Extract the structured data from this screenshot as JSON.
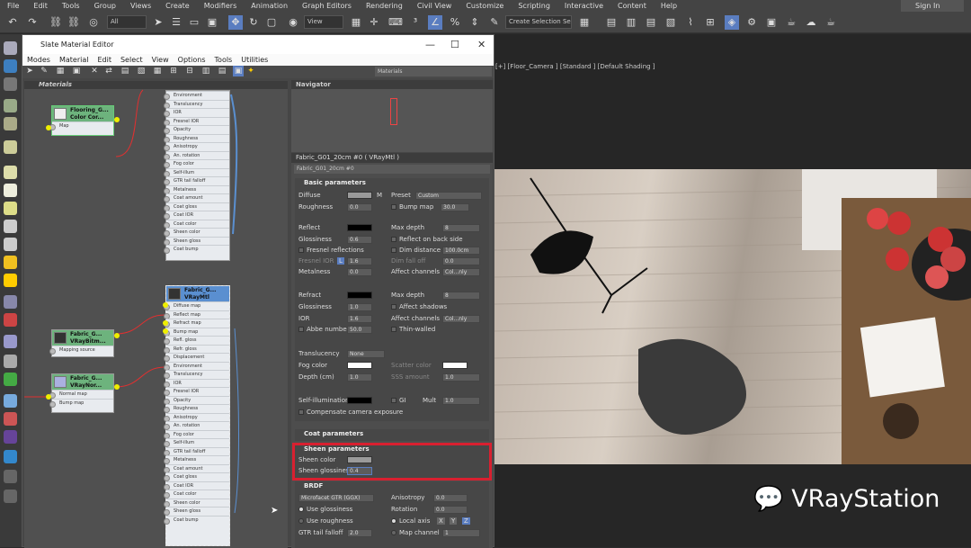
{
  "menubar": [
    "File",
    "Edit",
    "Tools",
    "Group",
    "Views",
    "Create",
    "Modifiers",
    "Animation",
    "Graph Editors",
    "Rendering",
    "Civil View",
    "Customize",
    "Scripting",
    "Interactive",
    "Content",
    "Help"
  ],
  "signin": "Sign In",
  "toolbar": {
    "filter": "All",
    "view": "View",
    "selection_set": "Create Selection Se"
  },
  "viewport": {
    "label": "[+] [Floor_Camera ] [Standard ] [Default Shading ]",
    "watermark": "VRayStation"
  },
  "sme": {
    "title": "Slate Material Editor",
    "menu": [
      "Modes",
      "Material",
      "Edit",
      "Select",
      "View",
      "Options",
      "Tools",
      "Utilities"
    ],
    "material_dropdown": "Materials",
    "graph_header": "Materials",
    "navigator": "Navigator"
  },
  "nodes": {
    "flooring": {
      "title": "Flooring_G...",
      "sub": "Color Cor...",
      "slots": [
        "Map"
      ]
    },
    "fab_bitmap": {
      "title": "Fabric_G...",
      "sub": "VRayBitm...",
      "slots": [
        "Mapping source"
      ]
    },
    "fab_normal": {
      "title": "Fabric_G...",
      "sub": "VRayNor...",
      "slots": [
        "Normal map",
        "Bump map"
      ]
    },
    "top_vraymtl_slots": [
      "Environment",
      "Translucency",
      "IOR",
      "Fresnel IOR",
      "Opacity",
      "Roughness",
      "Anisotropy",
      "An. rotation",
      "Fog color",
      "Self-illum",
      "GTR tail falloff",
      "Metalness",
      "Coat amount",
      "Coat gloss",
      "Coat IOR",
      "Coat color",
      "Sheen color",
      "Sheen gloss",
      "Coat bump"
    ],
    "fab_vraymtl": {
      "title": "Fabric_G...",
      "sub": "VRayMtl",
      "slots": [
        "Diffuse map",
        "Reflect map",
        "Refract map",
        "Bump map",
        "Refl. gloss",
        "Refr. gloss",
        "Displacement",
        "Environment",
        "Translucency",
        "IOR",
        "Fresnel IOR",
        "Opacity",
        "Roughness",
        "Anisotropy",
        "An. rotation",
        "Fog color",
        "Self-illum",
        "GTR tail falloff",
        "Metalness",
        "Coat amount",
        "Coat gloss",
        "Coat IOR",
        "Coat color",
        "Sheen color",
        "Sheen gloss",
        "Coat bump"
      ]
    }
  },
  "params": {
    "name": "Fabric_G01_20cm #0  ( VRayMtl )",
    "name_field": "Fabric_G01_20cm #0",
    "basic": {
      "header": "Basic parameters",
      "diffuse": "Diffuse",
      "m": "M",
      "preset": "Preset",
      "preset_val": "Custom",
      "roughness": "Roughness",
      "roughness_val": "0.0",
      "bump_map": "Bump map",
      "bump_val": "30.0",
      "reflect": "Reflect",
      "max_depth": "Max depth",
      "max_depth_val": "8",
      "glossiness": "Glossiness",
      "gloss_val": "0.6",
      "reflect_back": "Reflect on back side",
      "fresnel": "Fresnel reflections",
      "dim_distance": "Dim distance",
      "dim_val": "100.0cm",
      "fresnel_ior": "Fresnel IOR",
      "l": "L",
      "fior_val": "1.6",
      "dim_falloff": "Dim fall off",
      "dimf_val": "0.0",
      "metalness": "Metalness",
      "metal_val": "0.0",
      "affect_channels": "Affect channels",
      "aff_val": "Col...nly",
      "refract": "Refract",
      "max_depth2_val": "8",
      "r_gloss_val": "1.0",
      "affect_shadows": "Affect shadows",
      "ior": "IOR",
      "ior_val": "1.6",
      "aff2_val": "Col...nly",
      "abbe": "Abbe number",
      "abbe_val": "50.0",
      "thin": "Thin-walled",
      "translucency": "Translucency",
      "trans_val": "None",
      "fog_color": "Fog color",
      "scatter": "Scatter color",
      "depth": "Depth (cm)",
      "depth_val": "1.0",
      "sss": "SSS amount",
      "sss_val": "1.0",
      "selfillum": "Self-illumination",
      "gi": "GI",
      "mult": "Mult",
      "mult_val": "1.0",
      "compensate": "Compensate camera exposure"
    },
    "coat": {
      "header": "Coat parameters"
    },
    "sheen": {
      "header": "Sheen parameters",
      "color": "Sheen color",
      "gloss": "Sheen glossiness",
      "gloss_val": "0.4"
    },
    "brdf": {
      "header": "BRDF",
      "type": "Microfacet GTR (GGX)",
      "use_gloss": "Use glossiness",
      "use_rough": "Use roughness",
      "gtr": "GTR tail falloff",
      "gtr_val": "2.0",
      "aniso": "Anisotropy",
      "aniso_val": "0.0",
      "rotation": "Rotation",
      "rot_val": "0.0",
      "local_axis": "Local axis",
      "x": "X",
      "y": "Y",
      "z": "Z",
      "map_channel": "Map channel",
      "mapch_val": "1"
    }
  }
}
